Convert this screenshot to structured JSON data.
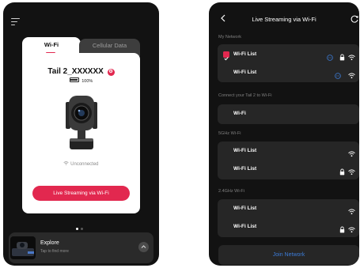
{
  "left_screen": {
    "tabs": [
      {
        "label": "Wi-Fi",
        "active": true
      },
      {
        "label": "Cellular Data",
        "active": false
      }
    ],
    "device_name": "Tail 2_XXXXXX",
    "battery": "100%",
    "status": "Unconnected",
    "action_button": "Live Streaming via Wi-Fi",
    "pager": {
      "pages": 2,
      "current": 1
    },
    "explore": {
      "title": "Explore",
      "subtitle": "Tap to find more"
    }
  },
  "right_screen": {
    "title": "Live Streaming via Wi-Fi",
    "sections": [
      {
        "label": "My Network",
        "items": [
          {
            "label": "Wi-Fi List",
            "checked": true,
            "info": true,
            "lock": true,
            "wifi": true
          },
          {
            "label": "Wi-Fi List",
            "checked": false,
            "info": true,
            "lock": false,
            "wifi": true
          }
        ]
      },
      {
        "label": "Connect your Tail 2 to Wi-Fi",
        "items": [
          {
            "label": "Wi-Fi"
          }
        ]
      },
      {
        "label": "5GHz Wi-Fi",
        "items": [
          {
            "label": "Wi-Fi List",
            "lock": false,
            "wifi": true
          },
          {
            "label": "Wi-Fi List",
            "lock": true,
            "wifi": true
          }
        ]
      },
      {
        "label": "2.4GHz Wi-Fi",
        "items": [
          {
            "label": "Wi-Fi List",
            "lock": false,
            "wifi": true
          },
          {
            "label": "Wi-Fi List",
            "lock": true,
            "wifi": true
          }
        ]
      }
    ],
    "join_button": "Join Network"
  },
  "colors": {
    "accent": "#e2284f",
    "link": "#3c7bd6",
    "background": "#121212",
    "card": "#262626"
  }
}
